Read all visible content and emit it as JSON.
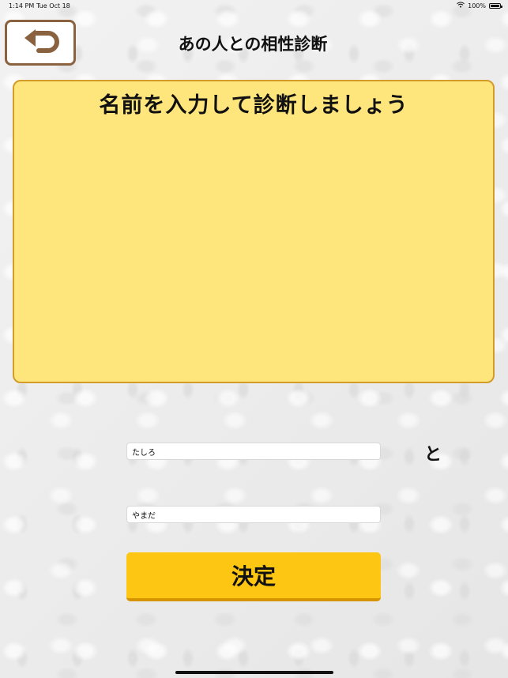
{
  "status_bar": {
    "time": "1:14 PM",
    "date": "Tue Oct 18",
    "battery": "100%",
    "icons": [
      "wifi-icon",
      "battery-icon"
    ]
  },
  "header": {
    "back_icon": "return-arrow-icon",
    "title": "あの人との相性診断"
  },
  "result": {
    "message": "名前を入力して診断しましょう"
  },
  "form": {
    "name1": {
      "value": "たしろ",
      "placeholder": ""
    },
    "connector": "と",
    "name2": {
      "value": "やまだ",
      "placeholder": ""
    },
    "submit_label": "決定"
  },
  "colors": {
    "panel_fill": "#fee57c",
    "panel_border": "#d39b29",
    "button_fill": "#fcc613",
    "button_shadow": "#d69400",
    "back_border": "#8b6240"
  }
}
